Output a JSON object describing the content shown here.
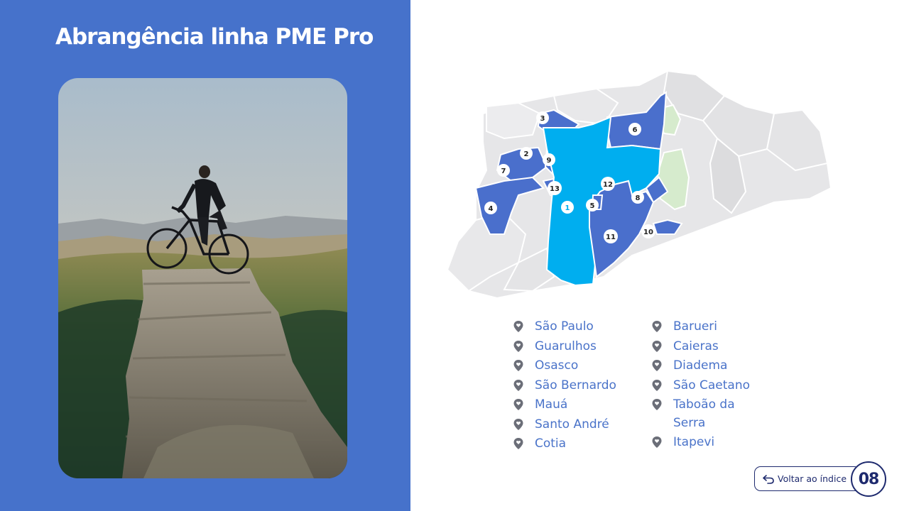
{
  "slide": {
    "title": "Abrangência linha PME Pro",
    "page_number": "08"
  },
  "navigation": {
    "back_label": "Voltar ao índice"
  },
  "colors": {
    "panel_blue": "#4672cb",
    "highlight_blue": "#00aeef",
    "region_blue": "#4a6fcc",
    "neighbor_gray": "#e4e4e6",
    "green_area": "#d8ecd0",
    "text_blue": "#4a73c9",
    "navy": "#1e2a6e"
  },
  "map": {
    "markers": [
      "1",
      "2",
      "3",
      "4",
      "5",
      "6",
      "7",
      "8",
      "9",
      "10",
      "11",
      "12",
      "13"
    ]
  },
  "legend": {
    "col1": [
      "São Paulo",
      "Guarulhos",
      "Osasco",
      "São Bernardo",
      "Mauá",
      "Santo André",
      "Cotia"
    ],
    "col2": [
      "Barueri",
      "Caieras",
      "Diadema",
      "São Caetano",
      "Taboão da Serra",
      "Itapevi"
    ]
  }
}
